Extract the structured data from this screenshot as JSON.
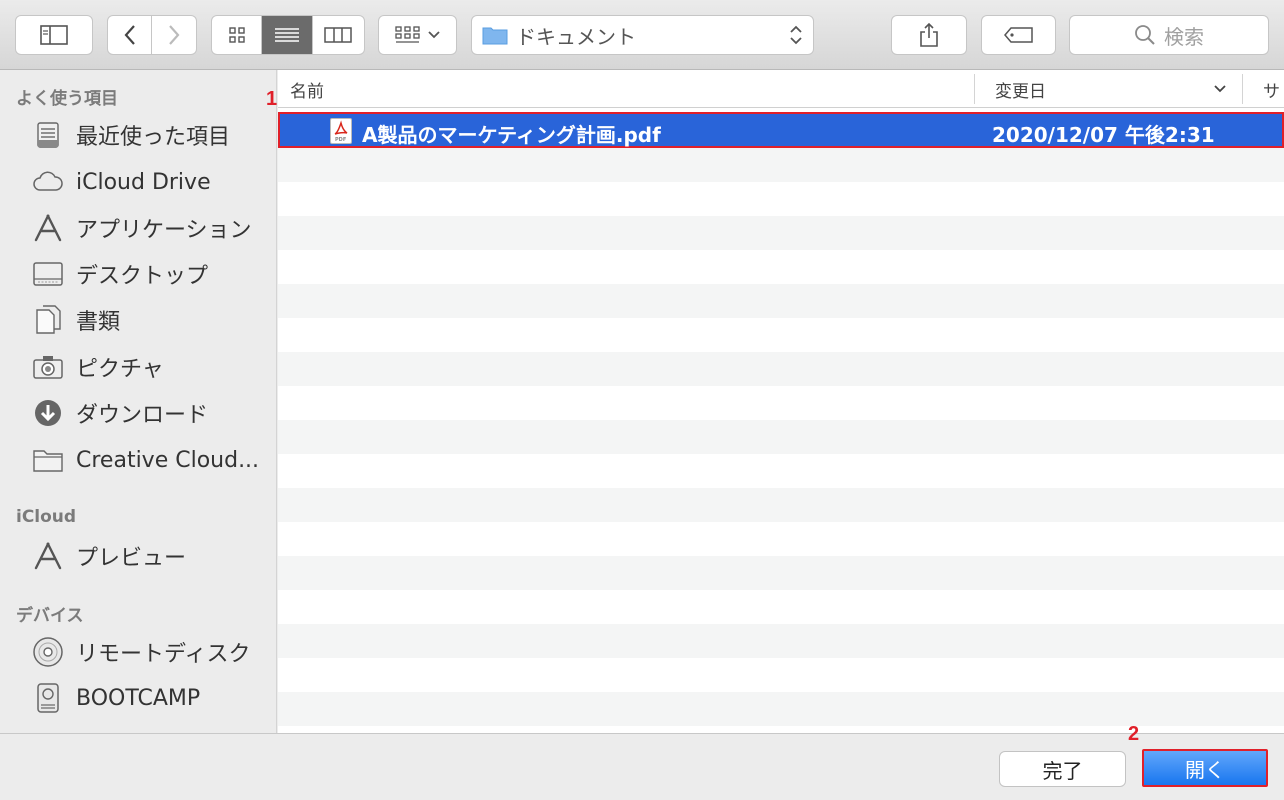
{
  "toolbar": {
    "path_label": "ドキュメント",
    "search_placeholder": "検索"
  },
  "sidebar": {
    "sections": [
      {
        "title": "よく使う項目"
      },
      {
        "title": "iCloud"
      },
      {
        "title": "デバイス"
      }
    ],
    "favorites": [
      {
        "label": "最近使った項目",
        "icon": "recents-icon"
      },
      {
        "label": "iCloud Drive",
        "icon": "cloud-icon"
      },
      {
        "label": "アプリケーション",
        "icon": "applications-icon"
      },
      {
        "label": "デスクトップ",
        "icon": "desktop-icon"
      },
      {
        "label": "書類",
        "icon": "documents-icon"
      },
      {
        "label": "ピクチャ",
        "icon": "camera-icon"
      },
      {
        "label": "ダウンロード",
        "icon": "download-icon"
      },
      {
        "label": "Creative Cloud...",
        "icon": "folder-icon"
      }
    ],
    "icloud": [
      {
        "label": "プレビュー",
        "icon": "preview-app-icon"
      }
    ],
    "devices": [
      {
        "label": "リモートディスク",
        "icon": "disc-icon"
      },
      {
        "label": "BOOTCAMP",
        "icon": "drive-icon"
      }
    ]
  },
  "filelist": {
    "columns": {
      "name": "名前",
      "modified": "変更日",
      "size": "サ"
    },
    "files": [
      {
        "name": "A製品のマーケティング計画.pdf",
        "modified": "2020/12/07 午後2:31",
        "icon": "pdf-icon",
        "selected": true
      }
    ]
  },
  "footer": {
    "done_label": "完了",
    "open_label": "開く"
  },
  "annotations": {
    "marker_1": "1",
    "marker_2": "2"
  },
  "colors": {
    "selection": "#2964d9",
    "primary_button": "#1876ef",
    "annotation": "#e0202a"
  }
}
